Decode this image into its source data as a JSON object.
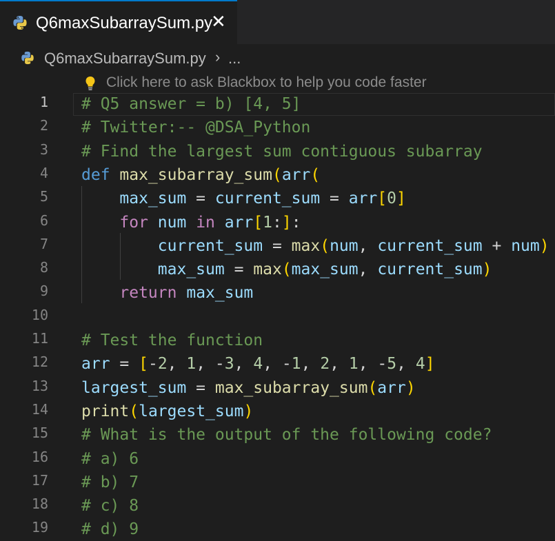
{
  "tab": {
    "title": "Q6maxSubarraySum.py",
    "close": "✕"
  },
  "breadcrumb": {
    "file": "Q6maxSubarraySum.py",
    "chevron": "›",
    "more": "..."
  },
  "hint": {
    "text": "Click here to ask Blackbox to help you code faster"
  },
  "editor": {
    "active_line": 1,
    "lines": [
      [
        [
          "c",
          "# Q5 answer = b) [4, 5]"
        ]
      ],
      [
        [
          "c",
          "# Twitter:-- @DSA_Python"
        ]
      ],
      [
        [
          "c",
          "# Find the largest sum contiguous subarray"
        ]
      ],
      [
        [
          "k",
          "def "
        ],
        [
          "f",
          "max_subarray_sum"
        ],
        [
          "b1",
          "("
        ],
        [
          "v",
          "arr"
        ],
        [
          "b1",
          "("
        ]
      ],
      [
        [
          "p",
          "    "
        ],
        [
          "v",
          "max_sum"
        ],
        [
          "p",
          " = "
        ],
        [
          "v",
          "current_sum"
        ],
        [
          "p",
          " = "
        ],
        [
          "v",
          "arr"
        ],
        [
          "b1",
          "["
        ],
        [
          "n",
          "0"
        ],
        [
          "b1",
          "]"
        ]
      ],
      [
        [
          "p",
          "    "
        ],
        [
          "x",
          "for"
        ],
        [
          "p",
          " "
        ],
        [
          "v",
          "num"
        ],
        [
          "p",
          " "
        ],
        [
          "x",
          "in"
        ],
        [
          "p",
          " "
        ],
        [
          "v",
          "arr"
        ],
        [
          "b1",
          "["
        ],
        [
          "n",
          "1"
        ],
        [
          "p",
          ":"
        ],
        [
          "b1",
          "]"
        ],
        [
          "p",
          ":"
        ]
      ],
      [
        [
          "p",
          "        "
        ],
        [
          "v",
          "current_sum"
        ],
        [
          "p",
          " = "
        ],
        [
          "f",
          "max"
        ],
        [
          "b1",
          "("
        ],
        [
          "v",
          "num"
        ],
        [
          "p",
          ", "
        ],
        [
          "v",
          "current_sum"
        ],
        [
          "p",
          " + "
        ],
        [
          "v",
          "num"
        ],
        [
          "b1",
          ")"
        ]
      ],
      [
        [
          "p",
          "        "
        ],
        [
          "v",
          "max_sum"
        ],
        [
          "p",
          " = "
        ],
        [
          "f",
          "max"
        ],
        [
          "b1",
          "("
        ],
        [
          "v",
          "max_sum"
        ],
        [
          "p",
          ", "
        ],
        [
          "v",
          "current_sum"
        ],
        [
          "b1",
          ")"
        ]
      ],
      [
        [
          "p",
          "    "
        ],
        [
          "x",
          "return"
        ],
        [
          "p",
          " "
        ],
        [
          "v",
          "max_sum"
        ]
      ],
      [],
      [
        [
          "c",
          "# Test the function"
        ]
      ],
      [
        [
          "v",
          "arr"
        ],
        [
          "p",
          " = "
        ],
        [
          "b1",
          "["
        ],
        [
          "p",
          "-"
        ],
        [
          "n",
          "2"
        ],
        [
          "p",
          ", "
        ],
        [
          "n",
          "1"
        ],
        [
          "p",
          ", -"
        ],
        [
          "n",
          "3"
        ],
        [
          "p",
          ", "
        ],
        [
          "n",
          "4"
        ],
        [
          "p",
          ", -"
        ],
        [
          "n",
          "1"
        ],
        [
          "p",
          ", "
        ],
        [
          "n",
          "2"
        ],
        [
          "p",
          ", "
        ],
        [
          "n",
          "1"
        ],
        [
          "p",
          ", -"
        ],
        [
          "n",
          "5"
        ],
        [
          "p",
          ", "
        ],
        [
          "n",
          "4"
        ],
        [
          "b1",
          "]"
        ]
      ],
      [
        [
          "v",
          "largest_sum"
        ],
        [
          "p",
          " = "
        ],
        [
          "f",
          "max_subarray_sum"
        ],
        [
          "b1",
          "("
        ],
        [
          "v",
          "arr"
        ],
        [
          "b1",
          ")"
        ]
      ],
      [
        [
          "f",
          "print"
        ],
        [
          "b1",
          "("
        ],
        [
          "v",
          "largest_sum"
        ],
        [
          "b1",
          ")"
        ]
      ],
      [
        [
          "c",
          "# What is the output of the following code?"
        ]
      ],
      [
        [
          "c",
          "# a) 6"
        ]
      ],
      [
        [
          "c",
          "# b) 7"
        ]
      ],
      [
        [
          "c",
          "# c) 8"
        ]
      ],
      [
        [
          "c",
          "# d) 9"
        ]
      ]
    ]
  },
  "colors": {
    "comment": "#6a9955",
    "keyword": "#569cd6",
    "control": "#c586c0",
    "function": "#dcdcaa",
    "variable": "#9cdcfe",
    "number": "#b5cea8",
    "bracket": "#ffd700"
  }
}
